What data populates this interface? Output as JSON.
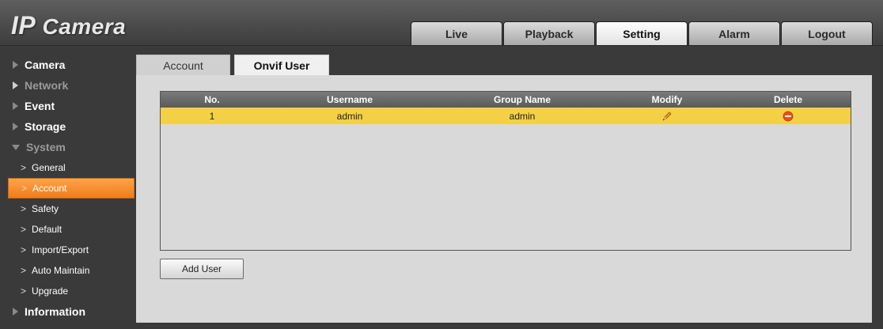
{
  "header": {
    "logo_ip": "IP",
    "logo_camera": "Camera",
    "nav": [
      {
        "label": "Live",
        "active": false
      },
      {
        "label": "Playback",
        "active": false
      },
      {
        "label": "Setting",
        "active": true
      },
      {
        "label": "Alarm",
        "active": false
      },
      {
        "label": "Logout",
        "active": false
      }
    ]
  },
  "sidebar": {
    "sections": [
      {
        "label": "Camera",
        "expanded": false
      },
      {
        "label": "Network",
        "expanded": false
      },
      {
        "label": "Event",
        "expanded": false
      },
      {
        "label": "Storage",
        "expanded": false
      },
      {
        "label": "System",
        "expanded": true
      },
      {
        "label": "Information",
        "expanded": false
      }
    ],
    "system_items": [
      {
        "label": "General",
        "active": false
      },
      {
        "label": "Account",
        "active": true
      },
      {
        "label": "Safety",
        "active": false
      },
      {
        "label": "Default",
        "active": false
      },
      {
        "label": "Import/Export",
        "active": false
      },
      {
        "label": "Auto Maintain",
        "active": false
      },
      {
        "label": "Upgrade",
        "active": false
      }
    ]
  },
  "content": {
    "tabs": [
      {
        "label": "Account",
        "active": false
      },
      {
        "label": "Onvif User",
        "active": true
      }
    ],
    "table": {
      "columns": [
        "No.",
        "Username",
        "Group Name",
        "Modify",
        "Delete"
      ],
      "rows": [
        {
          "no": "1",
          "username": "admin",
          "group": "admin",
          "modify_icon": "pencil-icon",
          "delete_icon": "delete-icon"
        }
      ]
    },
    "add_user_label": "Add User"
  },
  "colors": {
    "accent_orange": "#f07c1a",
    "selected_row": "#f4d046",
    "delete_red": "#e8501a"
  }
}
